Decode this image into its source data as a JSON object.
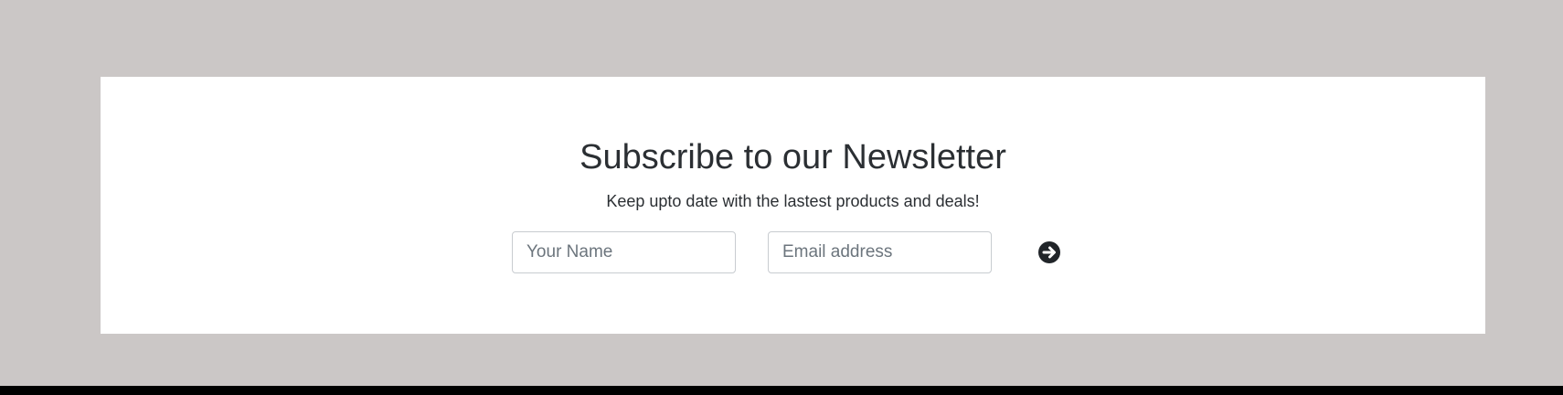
{
  "newsletter": {
    "title": "Subscribe to our Newsletter",
    "subtitle": "Keep upto date with the lastest products and deals!",
    "name_placeholder": "Your Name",
    "email_placeholder": "Email address",
    "submit_icon": "arrow-right-circle-icon"
  },
  "colors": {
    "page_background": "#cbc7c6",
    "card_background": "#ffffff",
    "text": "#2b2f33",
    "bottom_bar": "#000000"
  }
}
